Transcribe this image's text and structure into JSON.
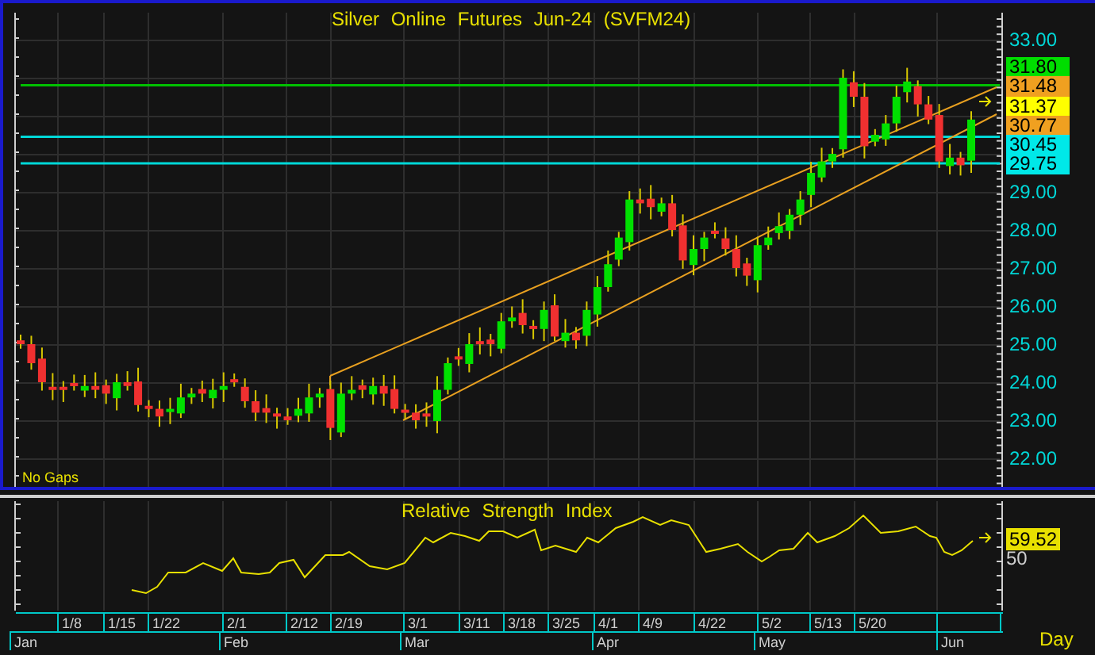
{
  "price_chart": {
    "title": "Silver Online Futures Jun-24 (SVFM24)",
    "axis_labels": [
      "33.00",
      "29.00",
      "28.00",
      "27.00",
      "26.00",
      "25.00",
      "24.00",
      "23.00",
      "22.00"
    ],
    "price_labels": [
      {
        "text": "31.80",
        "color": "#00dd00"
      },
      {
        "text": "31.48",
        "color": "#f0a020"
      },
      {
        "text": "31.37",
        "color": "#ffff00"
      },
      {
        "text": "30.77",
        "color": "#f0a020"
      },
      {
        "text": "30.45",
        "color": "#00e8e8"
      },
      {
        "text": "29.75",
        "color": "#00e8e8"
      }
    ],
    "note": "No Gaps"
  },
  "rsi_panel": {
    "title": "Relative Strength Index",
    "axis_label": "50",
    "value_label": "59.52"
  },
  "time_axis": {
    "weeks": [
      "1/8",
      "1/15",
      "1/22",
      "2/1",
      "2/12",
      "2/19",
      "3/1",
      "3/11",
      "3/18",
      "3/25",
      "4/1",
      "4/9",
      "4/22",
      "5/2",
      "5/13",
      "5/20"
    ],
    "months": [
      "Jan",
      "Feb",
      "Mar",
      "Apr",
      "May",
      "Jun"
    ],
    "interval": "Day"
  }
}
